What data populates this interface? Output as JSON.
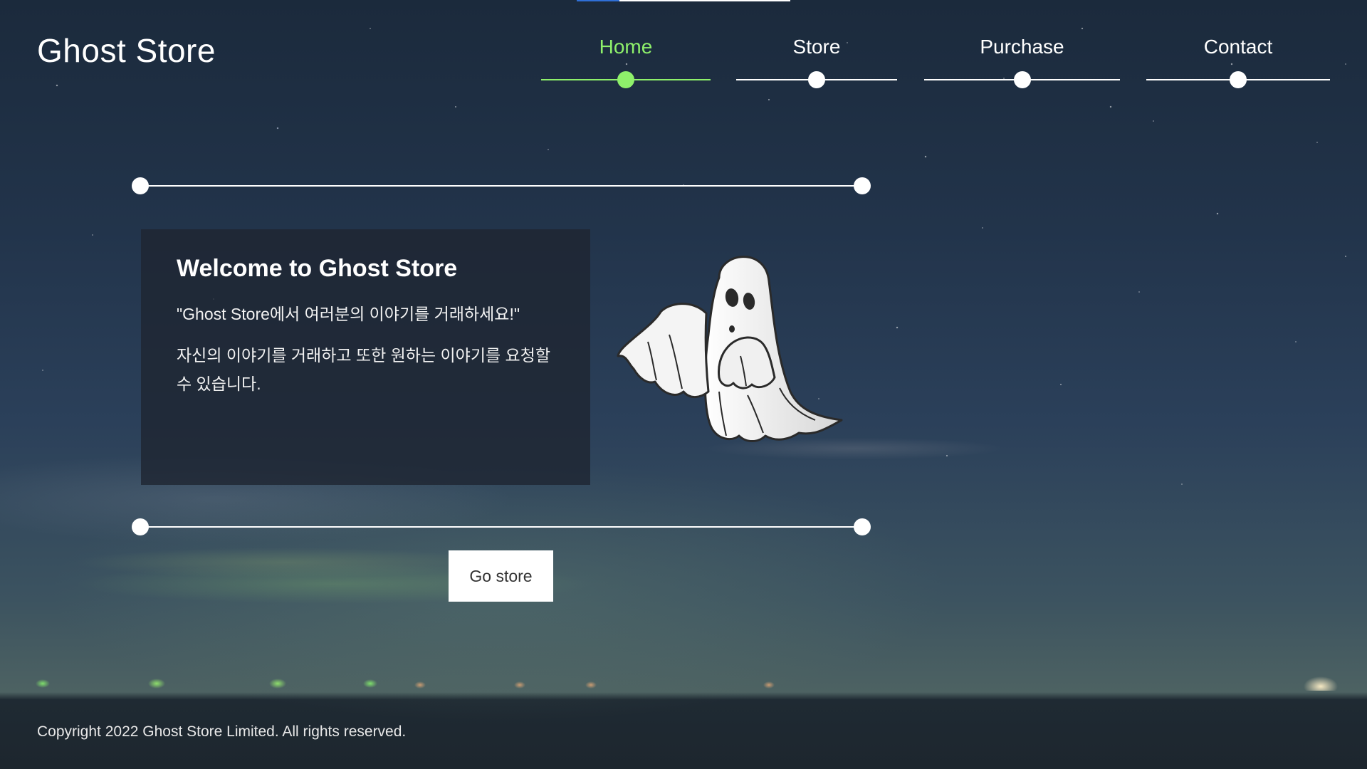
{
  "site": {
    "title": "Ghost Store"
  },
  "nav": {
    "items": [
      {
        "label": "Home",
        "active": true
      },
      {
        "label": "Store",
        "active": false
      },
      {
        "label": "Purchase",
        "active": false
      },
      {
        "label": "Contact",
        "active": false
      }
    ],
    "active_color": "#8ef06b"
  },
  "hero": {
    "title": "Welcome to Ghost Store",
    "tagline": "\"Ghost Store에서 여러분의 이야기를 거래하세요!\"",
    "description": "자신의 이야기를 거래하고 또한 원하는 이야기를 요청할 수 있습니다.",
    "illustration": "ghost-illustration"
  },
  "cta": {
    "label": "Go store"
  },
  "footer": {
    "copyright": "Copyright 2022 Ghost Store Limited. All rights reserved."
  },
  "icons": {
    "nav_marker": "dot-icon"
  }
}
